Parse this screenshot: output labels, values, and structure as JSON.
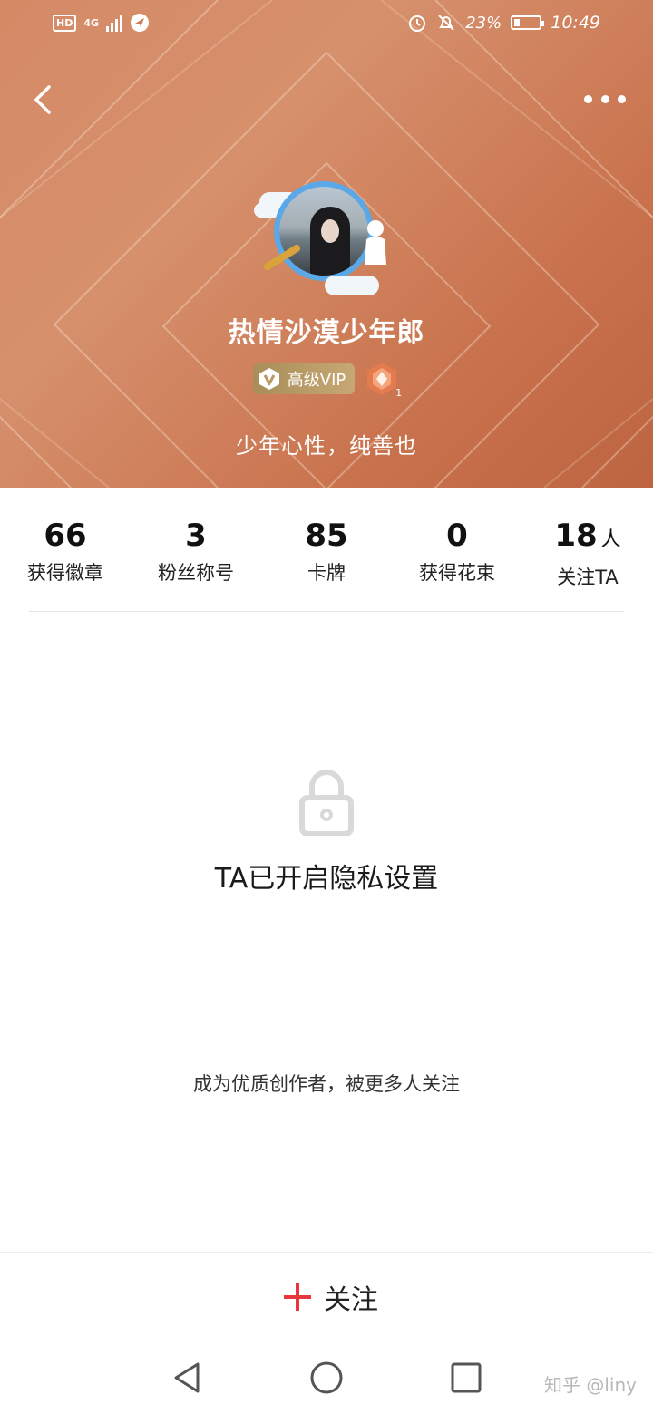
{
  "status_bar": {
    "hd": "HD",
    "network": "4G",
    "battery": "23%",
    "battery_level": 0.23,
    "time": "10:49"
  },
  "profile": {
    "username": "热情沙漠少年郎",
    "vip_label": "高级VIP",
    "level": "1",
    "bio": "少年心性，纯善也"
  },
  "stats": [
    {
      "value": "66",
      "unit": "",
      "label": "获得徽章"
    },
    {
      "value": "3",
      "unit": "",
      "label": "粉丝称号"
    },
    {
      "value": "85",
      "unit": "",
      "label": "卡牌"
    },
    {
      "value": "0",
      "unit": "",
      "label": "获得花束"
    },
    {
      "value": "18",
      "unit": "人",
      "label": "关注TA"
    }
  ],
  "privacy": {
    "message": "TA已开启隐私设置",
    "creator_prompt": "成为优质创作者，被更多人关注"
  },
  "actions": {
    "follow_label": "关注"
  },
  "watermark": "知乎 @liny",
  "colors": {
    "hero_start": "#d58a66",
    "hero_end": "#bd6440",
    "follow_plus": "#e8383d",
    "vip_gold": "#b89a64"
  }
}
